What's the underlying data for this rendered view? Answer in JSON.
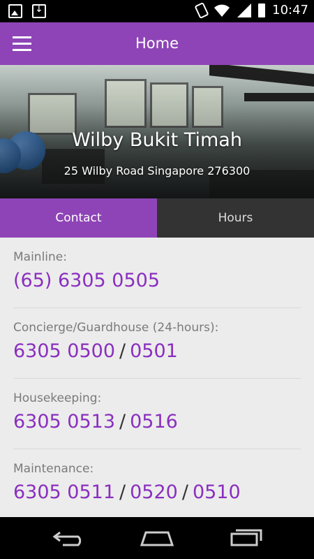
{
  "status_bar": {
    "time": "10:47",
    "left_icons": [
      "picture-icon",
      "download-icon"
    ],
    "right_icons": [
      "phone-vibrate-icon",
      "wifi-icon",
      "signal-icon",
      "battery-icon"
    ]
  },
  "app_bar": {
    "title": "Home",
    "menu_icon": "hamburger-menu-icon",
    "color": "#8e44b6"
  },
  "hero": {
    "title": "Wilby Bukit Timah",
    "address": "25 Wilby Road Singapore 276300"
  },
  "tabs": [
    {
      "label": "Contact",
      "active": true
    },
    {
      "label": "Hours",
      "active": false
    }
  ],
  "contacts": [
    {
      "label": "Mainline:",
      "numbers": [
        "(65) 6305 0505"
      ]
    },
    {
      "label": "Concierge/Guardhouse (24-hours):",
      "numbers": [
        "6305 0500",
        "0501"
      ]
    },
    {
      "label": "Housekeeping:",
      "numbers": [
        "6305 0513",
        "0516"
      ]
    },
    {
      "label": "Maintenance:",
      "numbers": [
        "6305 0511",
        "0520",
        "0510"
      ]
    }
  ],
  "number_separator": "/",
  "nav_bar": {
    "buttons": [
      "back-icon",
      "home-icon",
      "recent-apps-icon"
    ]
  },
  "colors": {
    "accent": "#8e44b6",
    "link": "#8a2fbf",
    "inactive_tab": "#333333",
    "content_bg": "#ececec"
  }
}
